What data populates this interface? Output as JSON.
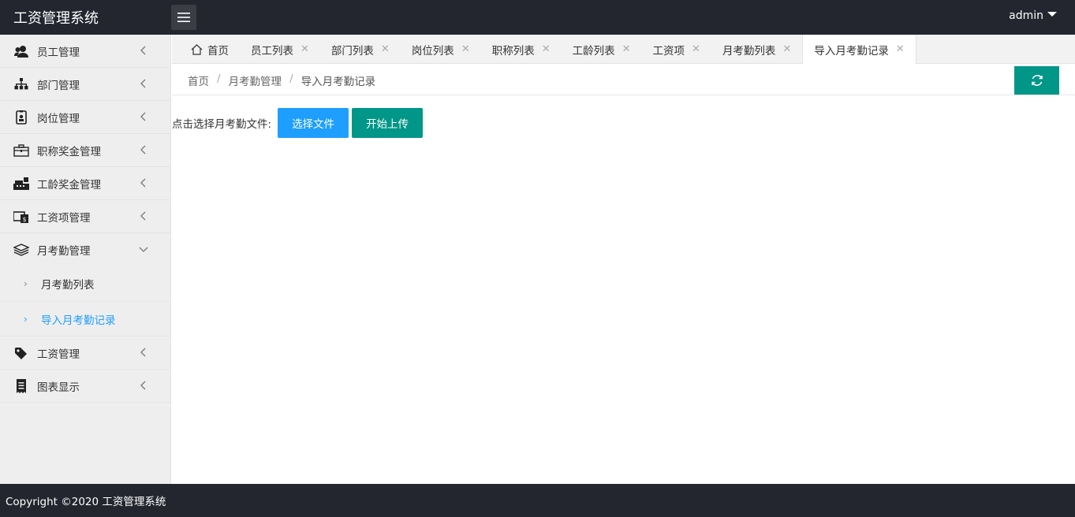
{
  "header": {
    "title": "工资管理系统",
    "user": "admin"
  },
  "sidebar": {
    "items": [
      {
        "label": "员工管理",
        "icon": "users-icon"
      },
      {
        "label": "部门管理",
        "icon": "sitemap-icon"
      },
      {
        "label": "岗位管理",
        "icon": "id-badge-icon"
      },
      {
        "label": "职称奖金管理",
        "icon": "briefcase-icon"
      },
      {
        "label": "工龄奖金管理",
        "icon": "cash-register-icon"
      },
      {
        "label": "工资项管理",
        "icon": "money-doc-icon"
      },
      {
        "label": "月考勤管理",
        "icon": "layers-icon"
      },
      {
        "label": "工资管理",
        "icon": "tags-icon"
      },
      {
        "label": "图表显示",
        "icon": "receipt-icon"
      }
    ],
    "submenu": [
      {
        "label": "月考勤列表"
      },
      {
        "label": "导入月考勤记录"
      }
    ]
  },
  "tabs": [
    {
      "label": "首页"
    },
    {
      "label": "员工列表"
    },
    {
      "label": "部门列表"
    },
    {
      "label": "岗位列表"
    },
    {
      "label": "职称列表"
    },
    {
      "label": "工龄列表"
    },
    {
      "label": "工资项"
    },
    {
      "label": "月考勤列表"
    },
    {
      "label": "导入月考勤记录"
    }
  ],
  "breadcrumb": {
    "home": "首页",
    "parent": "月考勤管理",
    "current": "导入月考勤记录",
    "sep": "/"
  },
  "upload": {
    "label": "点击选择月考勤文件:",
    "choose_btn": "选择文件",
    "start_btn": "开始上传"
  },
  "footer": {
    "text": "Copyright ©2020 工资管理系统"
  },
  "colors": {
    "header_bg": "#23262e",
    "accent_green": "#009688",
    "accent_blue": "#1E9FFF"
  }
}
